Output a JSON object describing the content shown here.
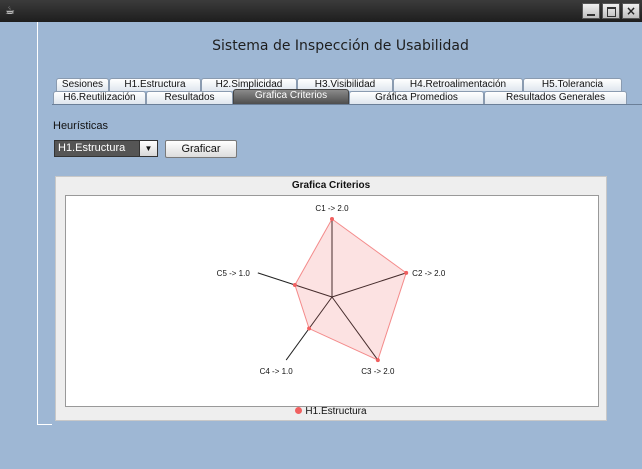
{
  "window": {
    "title": "Sistema de Inspección de Usabilidad"
  },
  "tabs_row1": [
    "Sesiones",
    "H1.Estructura",
    "H2.Simplicidad",
    "H3.Visibilidad",
    "H4.Retroalimentación",
    "H5.Tolerancia"
  ],
  "tabs_row2": [
    "H6.Reutilización",
    "Resultados",
    "Grafica Criterios",
    "Gráfica Promedios",
    "Resultados Generales"
  ],
  "selected_tab": "Grafica Criterios",
  "controls": {
    "heuristics_label": "Heurísticas",
    "heuristic_selected": "H1.Estructura",
    "graph_button": "Graficar"
  },
  "chart_data": {
    "type": "radar",
    "title": "Grafica Criterios",
    "categories": [
      "C1",
      "C2",
      "C3",
      "C4",
      "C5"
    ],
    "axis_labels": [
      "C1 -> 2.0",
      "C2 -> 2.0",
      "C3 -> 2.0",
      "C4 -> 1.0",
      "C5 -> 1.0"
    ],
    "series": [
      {
        "name": "H1.Estructura",
        "values": [
          2.0,
          2.0,
          2.0,
          1.0,
          1.0
        ],
        "color": "#f06060"
      }
    ],
    "max": 2.0,
    "legend": "bottom"
  }
}
